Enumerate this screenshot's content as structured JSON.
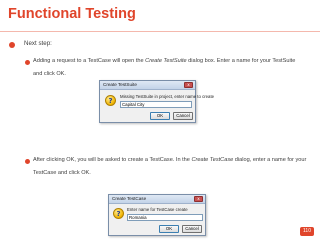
{
  "slide": {
    "title": "Functional Testing",
    "step_label": "Next step:",
    "para1": {
      "before": "Adding a request to a TestCase will open the ",
      "italic": "Create TestSuite",
      "after": " dialog box. Enter a name for your TestSuite",
      "line2": "and click OK."
    },
    "para2": {
      "before": "After clicking OK, you will be asked to create a TestCase. In the ",
      "italic": "Create TestCase",
      "after": " dialog, enter a name for your",
      "line2": "TestCase and click OK."
    },
    "page_number": "110"
  },
  "dialog1": {
    "title": "Create TestSuite",
    "close_glyph": "x",
    "prompt": "Missing TestSuite in project, enter name to create",
    "input_value": "Capital City",
    "ok_label": "OK",
    "cancel_label": "Cancel"
  },
  "dialog2": {
    "title": "Create TestCase",
    "close_glyph": "x",
    "prompt": "Enter name for TestCase create",
    "input_value": "Romania",
    "ok_label": "OK",
    "cancel_label": "Cancel"
  },
  "colors": {
    "accent": "#e0452b",
    "body_text": "#404040"
  }
}
